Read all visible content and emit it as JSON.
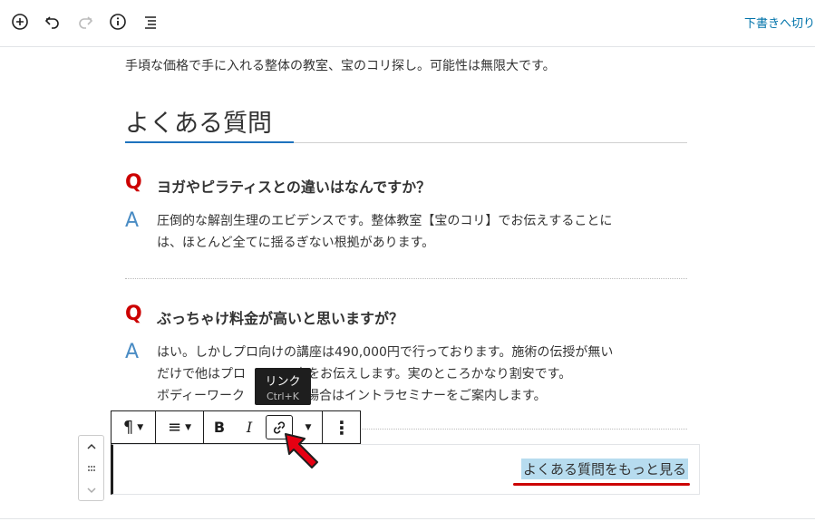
{
  "toolbar": {
    "icons": [
      "add-block-icon",
      "undo-icon",
      "redo-icon",
      "info-icon",
      "outline-icon"
    ],
    "save_draft": "下書きへ切り"
  },
  "content": {
    "cut_line": "…………………………………………………………",
    "intro": "手頃な価格で手に入れる整体の教室、宝のコリ探し。可能性は無限大です。",
    "heading": "よくある質問",
    "qa": [
      {
        "q_mark": "Q",
        "question": "ヨガやピラティスとの違いはなんですか？",
        "a_mark": "A",
        "answer_lines": [
          "圧倒的な解剖生理のエビデンスです。整体教室【宝のコリ】でお伝えすることに",
          "は、ほとんど全てに揺るぎない根拠があります。"
        ]
      },
      {
        "q_mark": "Q",
        "question": "ぶっちゃけ料金が高いと思いますが？",
        "a_mark": "A",
        "answer_lines": [
          "はい。しかしプロ向けの講座は490,000円で行っております。施術の伝授が無い",
          "だけで他はプロ",
          "ボディーワーク"
        ],
        "answer_lines_rest": [
          "の事をお伝えします。実のところかなり割安です。",
          "たい場合はイントラセミナーをご案内します。"
        ]
      }
    ]
  },
  "tooltip": {
    "label": "リンク",
    "shortcut": "Ctrl+K"
  },
  "block_toolbar": {
    "paragraph_icon": "¶",
    "align_icon": "≡",
    "bold": "B",
    "italic": "I",
    "more_icon": "⋮"
  },
  "block": {
    "link_text": "よくある質問をもっと見る"
  },
  "colors": {
    "q": "#cc0000",
    "a": "#4a8cc4",
    "accent": "#1e73be",
    "link": "#0073aa",
    "highlight": "#b7dcef"
  }
}
